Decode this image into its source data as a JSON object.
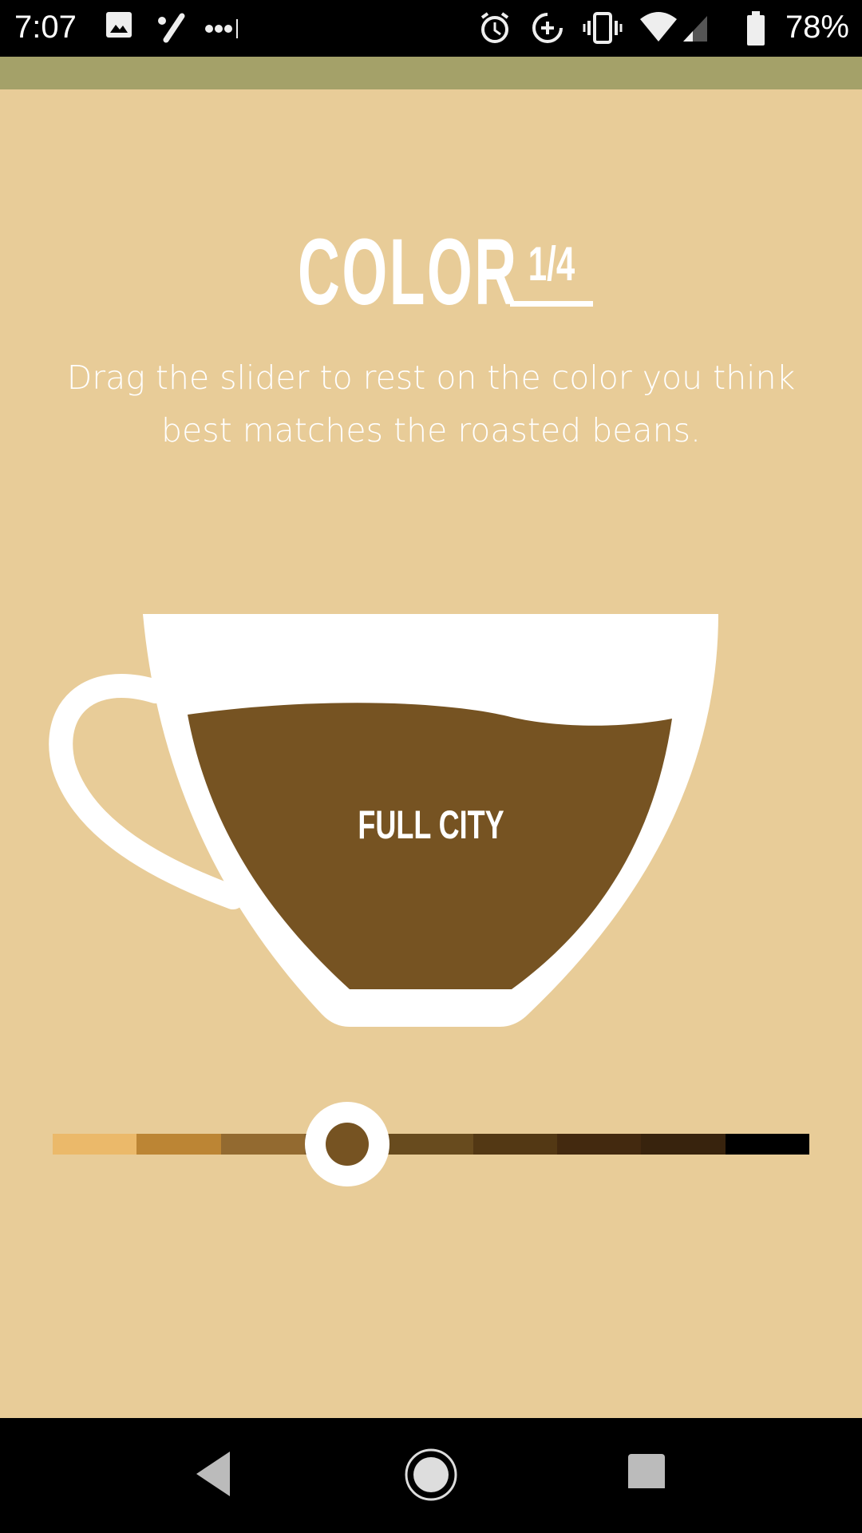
{
  "status_bar": {
    "time": "7:07",
    "battery_percent": "78%",
    "left_icons": [
      "image-icon",
      "pen-icon",
      "more-dots-icon"
    ],
    "right_icons": [
      "alarm-icon",
      "data-saver-icon",
      "vibrate-icon",
      "wifi-icon",
      "signal-icon",
      "battery-icon"
    ]
  },
  "header": {
    "title": "COLOR",
    "step": "1/4"
  },
  "instructions": "Drag the slider to rest on the color you think best matches the roasted beans.",
  "cup": {
    "roast_label": "FULL CITY",
    "coffee_color": "#765322"
  },
  "slider": {
    "selected_index": 3,
    "segment_count": 9,
    "segments": [
      "#EBB96A",
      "#BC8534",
      "#936A30",
      "#765322",
      "#684B1E",
      "#533814",
      "#43290F",
      "#38230D",
      "#000000"
    ]
  },
  "colors": {
    "background": "#E8CC98",
    "app_bar": "#A4A169"
  },
  "nav_bar": {
    "buttons": [
      "back-icon",
      "home-icon",
      "recents-icon"
    ]
  }
}
